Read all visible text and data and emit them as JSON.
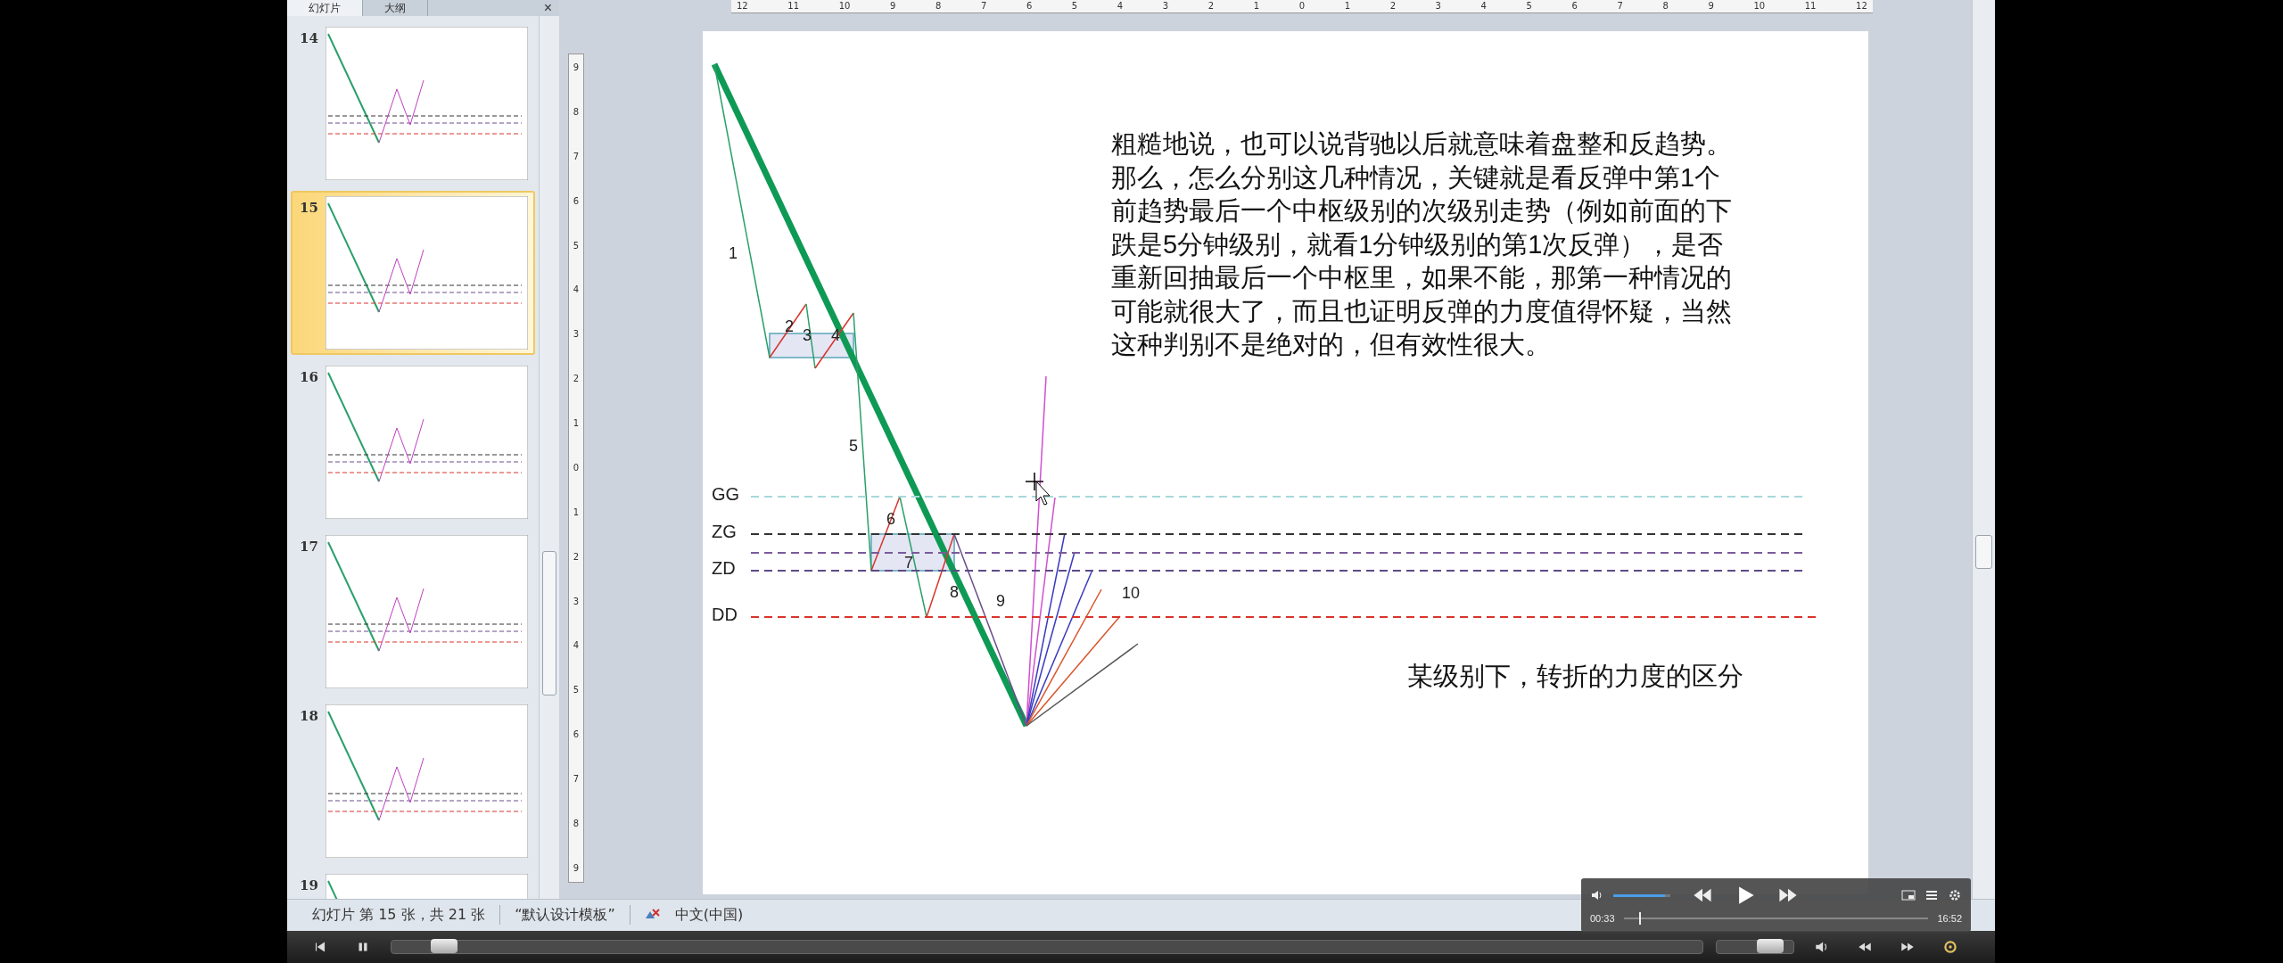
{
  "panel_tabs": [
    {
      "label": "幻灯片",
      "selected": true
    },
    {
      "label": "大纲",
      "selected": false
    }
  ],
  "panel_close": "×",
  "thumbnails": [
    {
      "number": "14",
      "selected": false
    },
    {
      "number": "15",
      "selected": true
    },
    {
      "number": "16",
      "selected": false
    },
    {
      "number": "17",
      "selected": false
    },
    {
      "number": "18",
      "selected": false
    },
    {
      "number": "19",
      "selected": false
    }
  ],
  "top_ruler": [
    "12",
    "11",
    "10",
    "9",
    "8",
    "7",
    "6",
    "5",
    "4",
    "3",
    "2",
    "1",
    "0",
    "1",
    "2",
    "3",
    "4",
    "5",
    "6",
    "7",
    "8",
    "9",
    "10",
    "11",
    "12"
  ],
  "side_ruler": [
    "9",
    "8",
    "7",
    "6",
    "5",
    "4",
    "3",
    "2",
    "1",
    "0",
    "1",
    "2",
    "3",
    "4",
    "5",
    "6",
    "7",
    "8",
    "9"
  ],
  "slide": {
    "paragraph_lines": [
      "粗糙地说，也可以说背驰以后就意味着盘整和反趋势。",
      "那么，怎么分别这几种情况，关键就是看反弹中第1个",
      "前趋势最后一个中枢级别的次级别走势（例如前面的下",
      "跌是5分钟级别，就看1分钟级别的第1次反弹），是否",
      "重新回抽最后一个中枢里，如果不能，那第一种情况的",
      "可能就很大了，而且也证明反弹的力度值得怀疑，当然",
      "这种判别不是绝对的，但有效性很大。"
    ],
    "caption": "某级别下，转折的力度的区分",
    "level_lines": [
      {
        "label": "GG",
        "color": "#a8d8dc"
      },
      {
        "label": "ZG",
        "color": "#333333"
      },
      {
        "color": "#7a5a9a"
      },
      {
        "label": "ZD",
        "color": "#5e4a86"
      },
      {
        "label": "DD",
        "color": "#d9342b"
      }
    ],
    "wave_labels": [
      "1",
      "2",
      "3",
      "4",
      "5",
      "6",
      "7",
      "8",
      "9",
      "10"
    ]
  },
  "status_bar": {
    "slide_count": "幻灯片 第 15 张，共 21 张",
    "theme": "“默认设计模板”",
    "language": "中文(中国)"
  },
  "player_overlay": {
    "volume": {
      "level": 0.9
    },
    "elapsed": "00:33",
    "duration": "16:52",
    "progress": {
      "level": 0.05
    }
  },
  "player_bar": {
    "seek": {
      "level": 0.04
    },
    "volume": {
      "level": 0.7
    }
  }
}
